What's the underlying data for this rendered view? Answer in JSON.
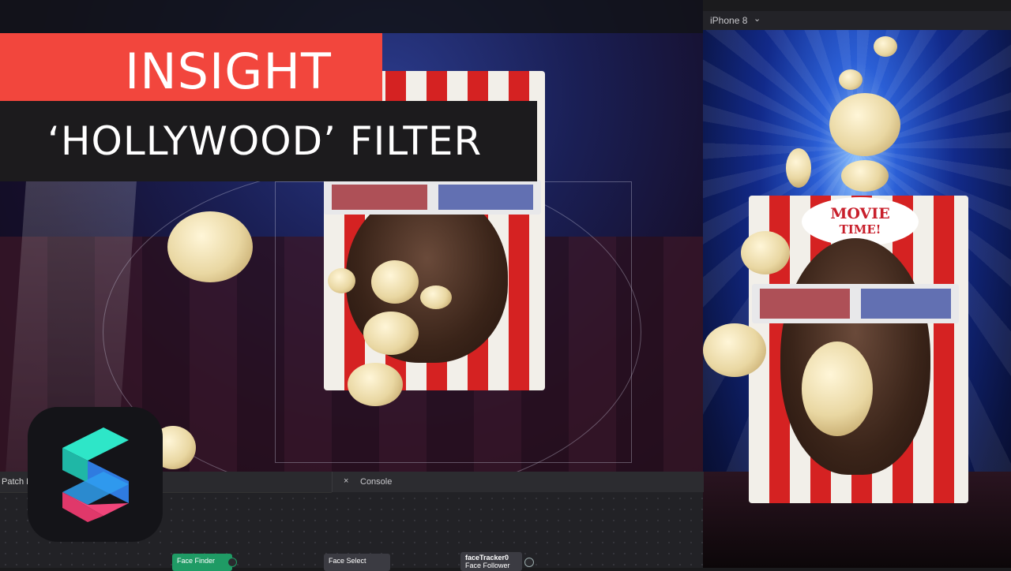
{
  "banner": {
    "line1": "INSIGHT",
    "line2": "‘HOLLYWOOD’ FILTER",
    "line1_bg": "#f2463d",
    "line2_bg": "#1c1b1d"
  },
  "preview": {
    "device_label": "iPhone 8",
    "device_chevron": "⌄",
    "sign_line1": "MOVIE",
    "sign_line2": "TIME!"
  },
  "bottom_panel": {
    "patch_tab_label": "Patch E",
    "console_close": "×",
    "console_label": "Console"
  },
  "patch_nodes": {
    "face_finder": "Face Finder",
    "face_select": "Face Select",
    "face_tracker_title": "faceTracker0",
    "face_tracker_sub": "Face Follower"
  },
  "colors": {
    "accent_red": "#f2463d",
    "node_green": "#1f9b65",
    "logo_cyan": "#2ee6c8",
    "logo_blue": "#2f7be0",
    "logo_pink": "#f0457a"
  },
  "icons": {
    "logo": "spark-ar-logo",
    "close": "close-icon",
    "chevron": "chevron-down-icon"
  }
}
